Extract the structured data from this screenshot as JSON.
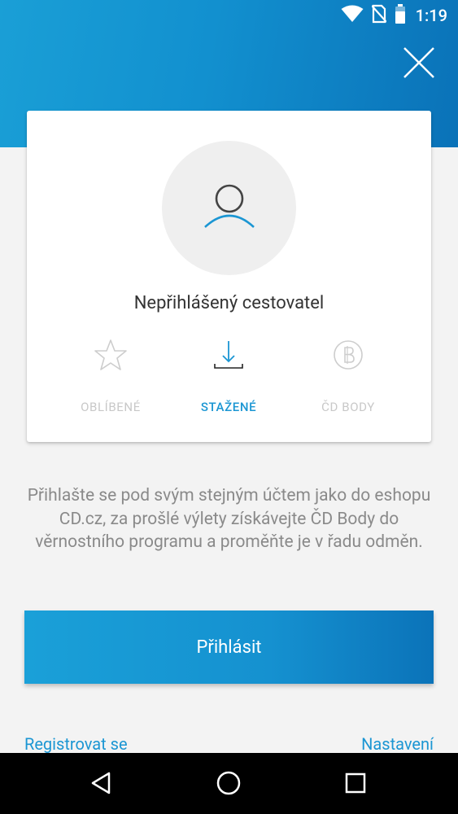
{
  "status_bar": {
    "time": "1:19",
    "icons": [
      "wifi-icon",
      "no-sim-icon",
      "battery-icon"
    ]
  },
  "header": {
    "close_icon": "close-icon",
    "colors": {
      "gradient_start": "#1a9fd6",
      "gradient_end": "#0a72b8"
    }
  },
  "profile": {
    "avatar_icon": "user-icon",
    "name": "Nepřihlášený cestovatel",
    "tabs": [
      {
        "label": "OBLÍBENÉ",
        "icon": "star-icon",
        "active": false
      },
      {
        "label": "STAŽENÉ",
        "icon": "download-icon",
        "active": true
      },
      {
        "label": "ČD BODY",
        "icon": "cd-points-icon",
        "active": false
      }
    ]
  },
  "info_text": "Přihlašte se pod svým stejným účtem jako do eshopu CD.cz, za prošlé výlety získávejte ČD Body do věrnostního programu a proměňte je v řadu odměn.",
  "login_button": {
    "label": "Přihlásit"
  },
  "links": {
    "register": "Registrovat se",
    "settings": "Nastavení"
  },
  "nav_bar": {
    "icons": [
      "back-icon",
      "home-icon",
      "recents-icon"
    ]
  },
  "colors": {
    "accent": "#1b96d3",
    "inactive": "#c8c8c8",
    "background": "#f3f3f3"
  }
}
